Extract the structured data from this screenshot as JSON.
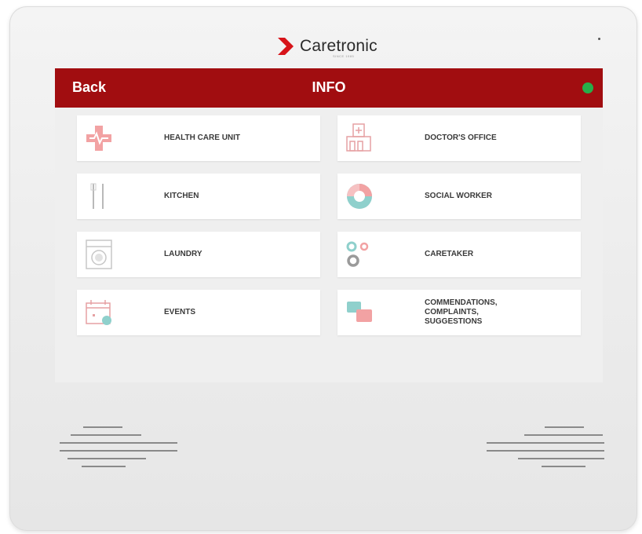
{
  "brand": {
    "name": "Caretronic",
    "tagline": "SINCE 1985"
  },
  "header": {
    "back_label": "Back",
    "title": "INFO",
    "status_color": "#27ae4a",
    "bar_color": "#a10d10"
  },
  "tiles": [
    {
      "label": "HEALTH CARE UNIT",
      "icon": "medical-cross-icon"
    },
    {
      "label": "DOCTOR'S OFFICE",
      "icon": "building-icon"
    },
    {
      "label": "KITCHEN",
      "icon": "cutlery-icon"
    },
    {
      "label": "SOCIAL WORKER",
      "icon": "pie-chart-icon"
    },
    {
      "label": "LAUNDRY",
      "icon": "washing-machine-icon"
    },
    {
      "label": "CARETAKER",
      "icon": "gears-icon"
    },
    {
      "label": "EVENTS",
      "icon": "calendar-icon"
    },
    {
      "label": "COMMENDATIONS, COMPLAINTS, SUGGESTIONS",
      "icon": "chat-bubbles-icon"
    }
  ]
}
